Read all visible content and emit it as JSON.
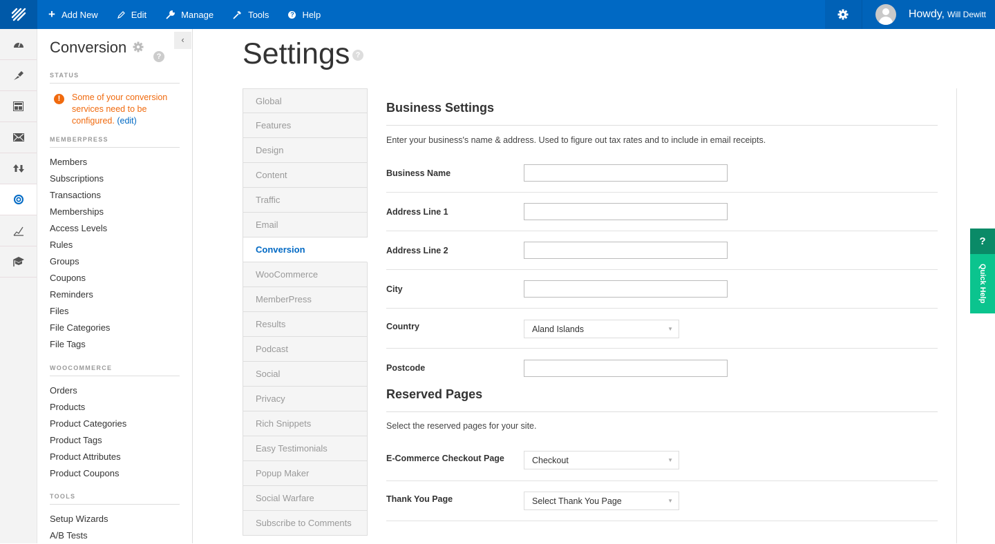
{
  "topbar": {
    "items": [
      {
        "label": "Add New",
        "icon": "plus-icon"
      },
      {
        "label": "Edit",
        "icon": "pencil-icon"
      },
      {
        "label": "Manage",
        "icon": "wrench-icon"
      },
      {
        "label": "Tools",
        "icon": "hammer-icon"
      },
      {
        "label": "Help",
        "icon": "help-icon"
      }
    ],
    "howdy": "Howdy,",
    "user_name": "Will Dewitt"
  },
  "rail": {
    "items": [
      "dashboard-icon",
      "paintbrush-icon",
      "layout-icon",
      "envelope-icon",
      "updown-arrows-icon",
      "target-icon",
      "chart-icon",
      "mortarboard-icon"
    ],
    "active_index": 5
  },
  "sidebar": {
    "title": "Conversion",
    "status_heading": "STATUS",
    "status_message": "Some of your conversion services need to be configured.",
    "status_link": "(edit)",
    "sections": [
      {
        "heading": "MEMBERPRESS",
        "links": [
          "Members",
          "Subscriptions",
          "Transactions",
          "Memberships",
          "Access Levels",
          "Rules",
          "Groups",
          "Coupons",
          "Reminders",
          "Files",
          "File Categories",
          "File Tags"
        ]
      },
      {
        "heading": "WOOCOMMERCE",
        "links": [
          "Orders",
          "Products",
          "Product Categories",
          "Product Tags",
          "Product Attributes",
          "Product Coupons"
        ]
      },
      {
        "heading": "TOOLS",
        "links": [
          "Setup Wizards",
          "A/B Tests"
        ]
      }
    ]
  },
  "main": {
    "title": "Settings",
    "tabs": [
      "Global",
      "Features",
      "Design",
      "Content",
      "Traffic",
      "Email",
      "Conversion",
      "WooCommerce",
      "MemberPress",
      "Results",
      "Podcast",
      "Social",
      "Privacy",
      "Rich Snippets",
      "Easy Testimonials",
      "Popup Maker",
      "Social Warfare",
      "Subscribe to Comments"
    ],
    "active_tab": "Conversion",
    "business": {
      "title": "Business Settings",
      "description": "Enter your business's name & address. Used to figure out tax rates and to include in email receipts.",
      "fields": [
        {
          "label": "Business Name",
          "type": "text",
          "value": ""
        },
        {
          "label": "Address Line 1",
          "type": "text",
          "value": ""
        },
        {
          "label": "Address Line 2",
          "type": "text",
          "value": ""
        },
        {
          "label": "City",
          "type": "text",
          "value": ""
        },
        {
          "label": "Country",
          "type": "select",
          "value": "Aland Islands"
        },
        {
          "label": "Postcode",
          "type": "text",
          "value": ""
        }
      ]
    },
    "reserved": {
      "title": "Reserved Pages",
      "description": "Select the reserved pages for your site.",
      "fields": [
        {
          "label": "E-Commerce Checkout Page",
          "type": "select",
          "value": "Checkout"
        },
        {
          "label": "Thank You Page",
          "type": "select",
          "value": "Select Thank You Page"
        }
      ]
    }
  },
  "quick_help": {
    "icon": "?",
    "label": "Quick Help"
  },
  "colors": {
    "brand": "#0069c4",
    "warning": "#f06a0e",
    "quick_help": "#0bc48e"
  }
}
